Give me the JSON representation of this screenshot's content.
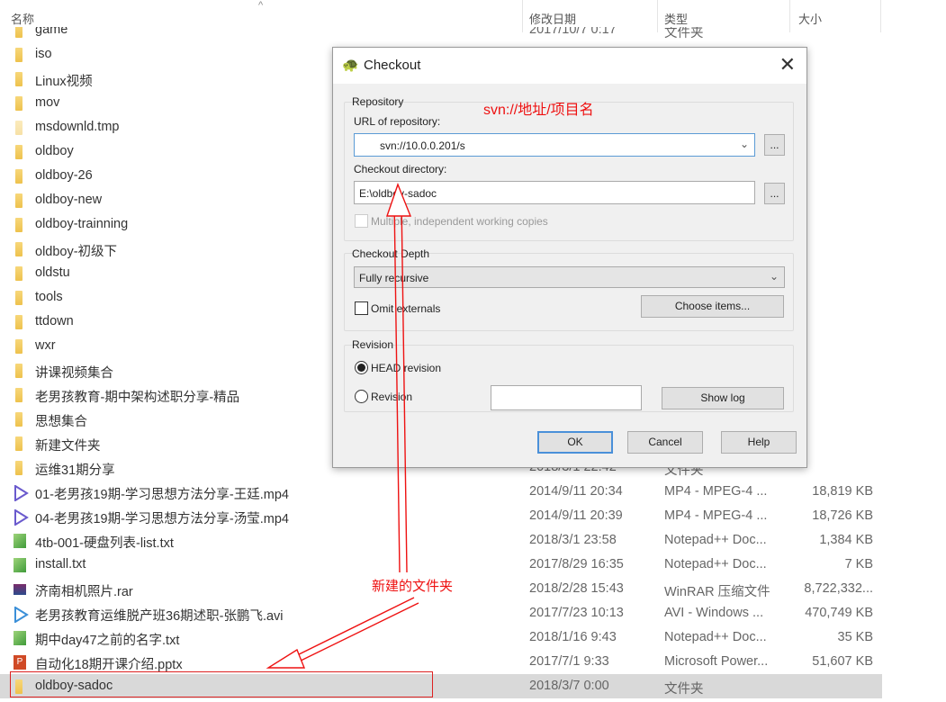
{
  "explorer": {
    "columns": {
      "name": "名称",
      "date": "修改日期",
      "type": "类型",
      "size": "大小"
    },
    "rows": [
      {
        "name": "game",
        "date": "2017/10/7 0:17",
        "type": "文件夹",
        "size": "",
        "icon": "folder"
      },
      {
        "name": "iso",
        "icon": "folder"
      },
      {
        "name": "Linux视频",
        "icon": "folder"
      },
      {
        "name": "mov",
        "icon": "folder"
      },
      {
        "name": "msdownld.tmp",
        "icon": "folder-light"
      },
      {
        "name": "oldboy",
        "icon": "folder"
      },
      {
        "name": "oldboy-26",
        "icon": "folder"
      },
      {
        "name": "oldboy-new",
        "icon": "folder"
      },
      {
        "name": "oldboy-trainning",
        "icon": "folder"
      },
      {
        "name": "oldboy-初级下",
        "icon": "folder"
      },
      {
        "name": "oldstu",
        "icon": "folder"
      },
      {
        "name": "tools",
        "icon": "folder"
      },
      {
        "name": "ttdown",
        "icon": "folder"
      },
      {
        "name": "wxr",
        "icon": "folder"
      },
      {
        "name": "讲课视频集合",
        "icon": "folder"
      },
      {
        "name": "老男孩教育-期中架构述职分享-精品",
        "icon": "folder"
      },
      {
        "name": "思想集合",
        "icon": "folder"
      },
      {
        "name": "新建文件夹",
        "icon": "folder"
      },
      {
        "name": "运维31期分享",
        "date": "2018/3/1 22:42",
        "type": "文件夹",
        "icon": "folder"
      },
      {
        "name": "01-老男孩19期-学习思想方法分享-王廷.mp4",
        "date": "2014/9/11 20:34",
        "type": "MP4 - MPEG-4 ...",
        "size": "18,819 KB",
        "icon": "video"
      },
      {
        "name": "04-老男孩19期-学习思想方法分享-汤莹.mp4",
        "date": "2014/9/11 20:39",
        "type": "MP4 - MPEG-4 ...",
        "size": "18,726 KB",
        "icon": "video"
      },
      {
        "name": "4tb-001-硬盘列表-list.txt",
        "date": "2018/3/1 23:58",
        "type": "Notepad++ Doc...",
        "size": "1,384 KB",
        "icon": "notepad"
      },
      {
        "name": "install.txt",
        "date": "2017/8/29 16:35",
        "type": "Notepad++ Doc...",
        "size": "7 KB",
        "icon": "notepad"
      },
      {
        "name": "济南相机照片.rar",
        "date": "2018/2/28 15:43",
        "type": "WinRAR 压缩文件",
        "size": "8,722,332...",
        "icon": "rar"
      },
      {
        "name": "老男孩教育运维脱产班36期述职-张鹏飞.avi",
        "date": "2017/7/23 10:13",
        "type": "AVI - Windows ...",
        "size": "470,749 KB",
        "icon": "video-blue"
      },
      {
        "name": "期中day47之前的名字.txt",
        "date": "2018/1/16 9:43",
        "type": "Notepad++ Doc...",
        "size": "35 KB",
        "icon": "notepad"
      },
      {
        "name": "自动化18期开课介绍.pptx",
        "date": "2017/7/1 9:33",
        "type": "Microsoft Power...",
        "size": "51,607 KB",
        "icon": "pptx"
      },
      {
        "name": "oldboy-sadoc",
        "date": "2018/3/7 0:00",
        "type": "文件夹",
        "size": "",
        "icon": "folder",
        "selected": true
      }
    ]
  },
  "dialog": {
    "title": "Checkout",
    "repository_group": "Repository",
    "url_label": "URL of repository:",
    "url_value": "svn://10.0.0.201/s",
    "dir_label": "Checkout directory:",
    "dir_value": "E:\\oldboy-sadoc",
    "browse": "...",
    "multiple_label": "Multiple, independent working copies",
    "depth_group": "Checkout Depth",
    "depth_value": "Fully recursive",
    "omit_label": "Omit externals",
    "choose_items": "Choose items...",
    "revision_group": "Revision",
    "head_label": "HEAD revision",
    "revision_label": "Revision",
    "revision_value": "",
    "show_log": "Show log",
    "ok": "OK",
    "cancel": "Cancel",
    "help": "Help"
  },
  "annotations": {
    "url_hint": "svn://地址/项目名",
    "new_folder": "新建的文件夹",
    "color": "#e11111"
  }
}
